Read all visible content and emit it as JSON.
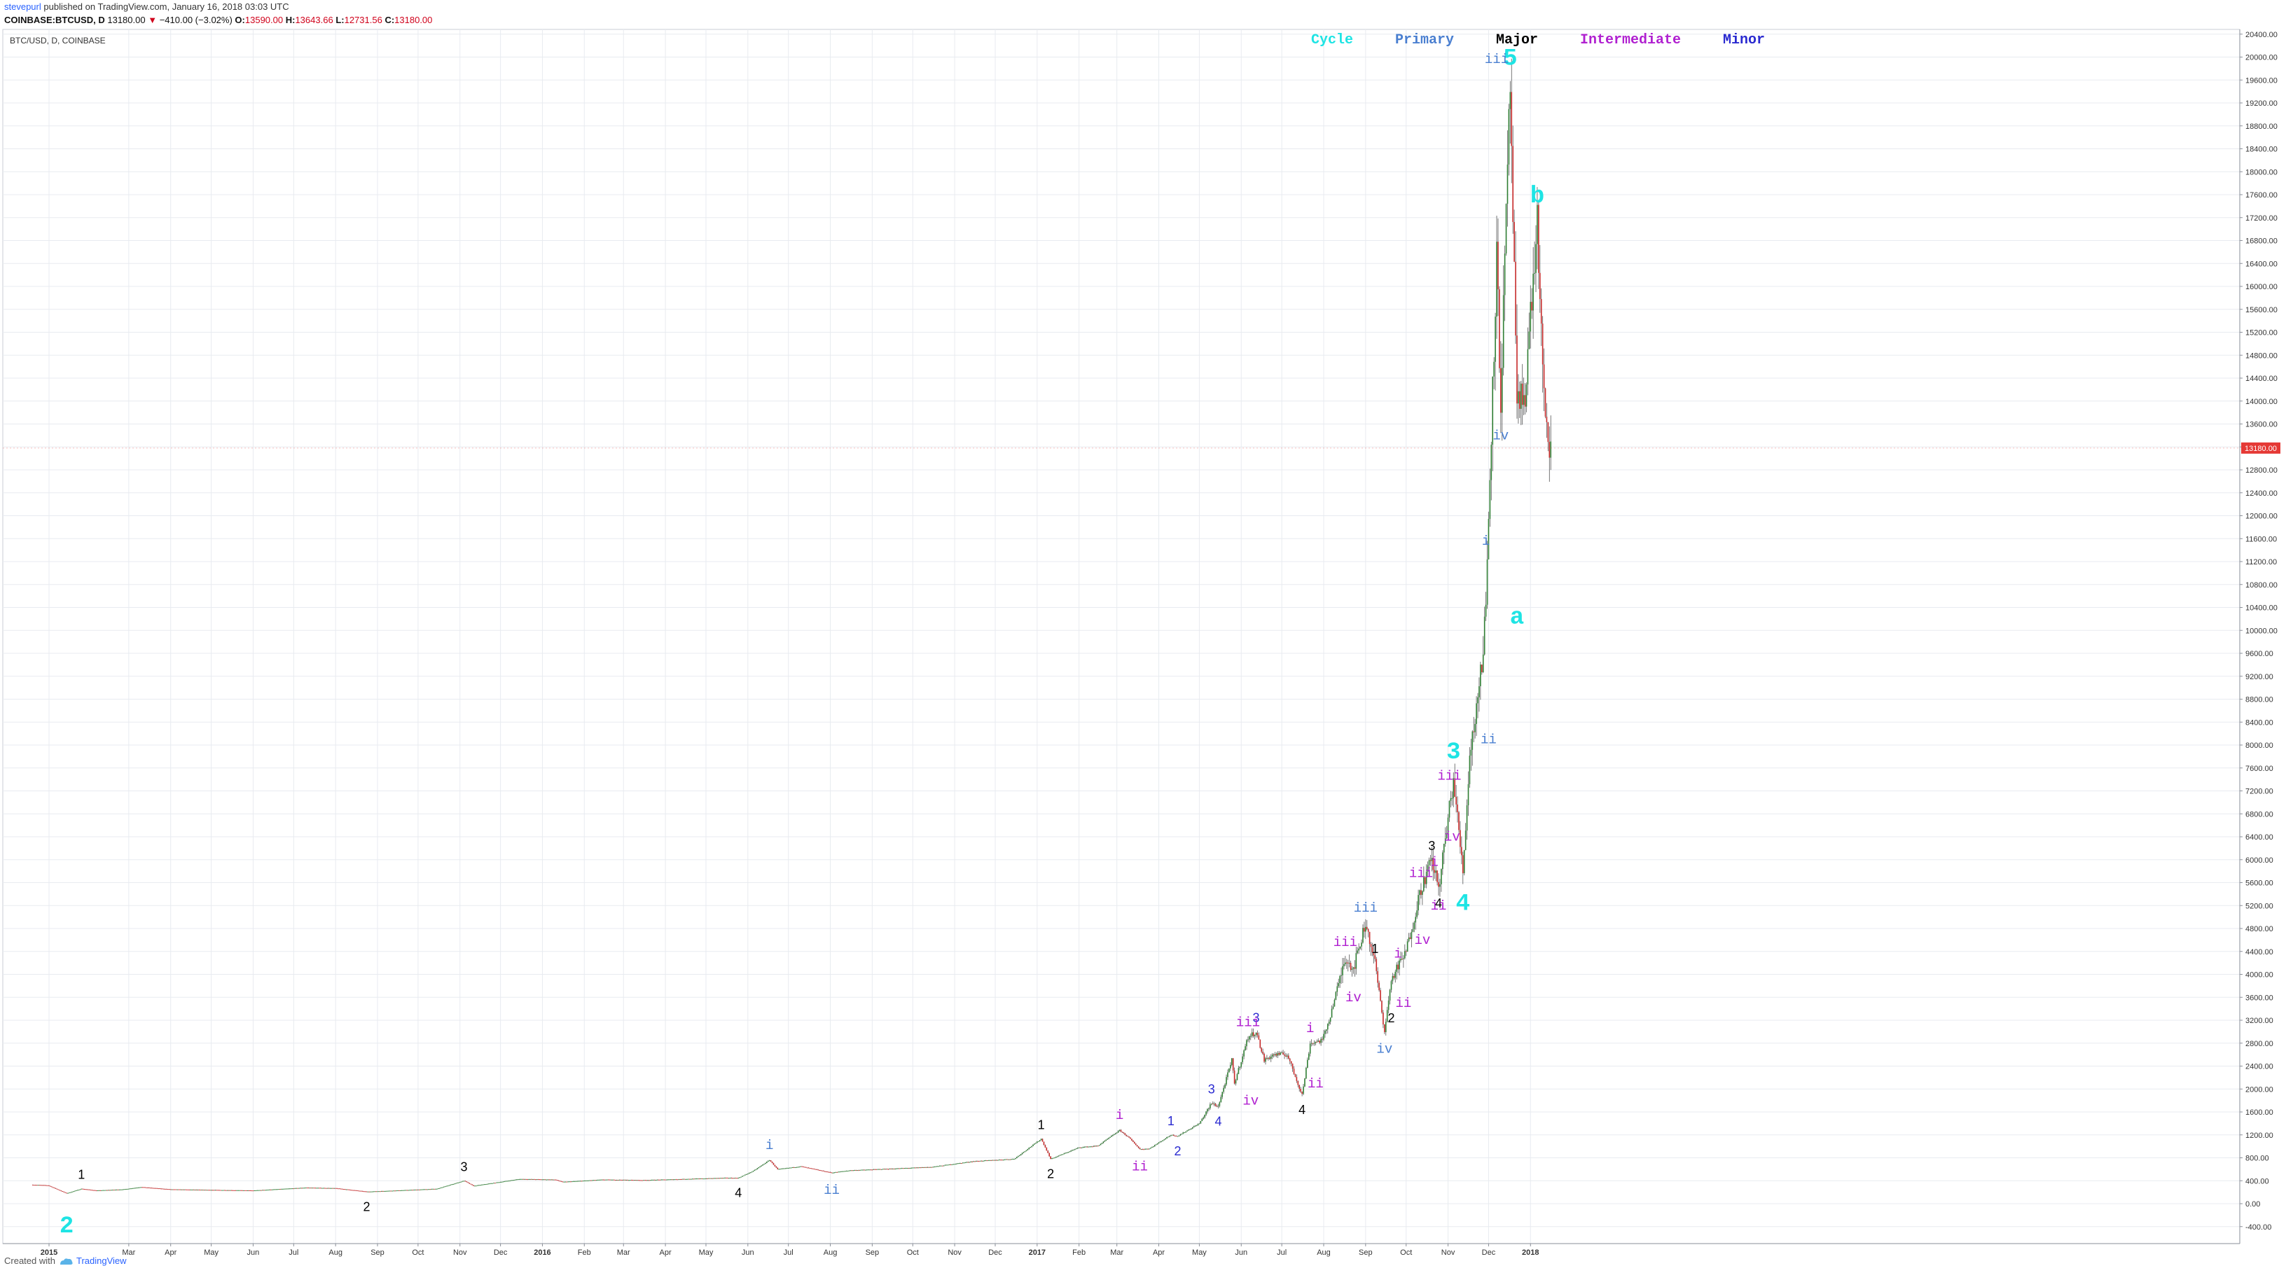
{
  "header": {
    "author": "stevepurl",
    "published": "published on TradingView.com, January 16, 2018 03:03 UTC",
    "symbol": "COINBASE:BTCUSD, D",
    "last": "13180.00",
    "last_arrow": "▼",
    "change": "−410.00 (−3.02%)",
    "o_label": "O:",
    "o_value": "13590.00",
    "h_label": "H:",
    "h_value": "13643.66",
    "l_label": "L:",
    "l_value": "12731.56",
    "c_label": "C:",
    "c_value": "13180.00"
  },
  "footer": {
    "created_with": "Created with",
    "brand": "TradingView"
  },
  "colors": {
    "cycle": "#1ee4e4",
    "primary": "#4a7fd0",
    "major": "#000000",
    "intermediate": "#b020d0",
    "minor": "#2a2ad0",
    "up": "#2e7d32",
    "down": "#c62828",
    "wick": "#555555",
    "price_tag": "#e53935",
    "grid": "#e8ebf0"
  },
  "chart_data": {
    "type": "candlestick",
    "title": "BTC/USD, D, COINBASE",
    "price_label": "13180.00",
    "ylim": [
      -400,
      20400
    ],
    "yticks": [
      -400,
      0,
      400,
      800,
      1200,
      1600,
      2000,
      2400,
      2800,
      3200,
      3600,
      4000,
      4400,
      4800,
      5200,
      5600,
      6000,
      6400,
      6800,
      7200,
      7600,
      8000,
      8400,
      8800,
      9200,
      9600,
      10000,
      10400,
      10800,
      11200,
      11600,
      12000,
      12400,
      12800,
      13200,
      13600,
      14000,
      14400,
      14800,
      15200,
      15600,
      16000,
      16400,
      16800,
      17200,
      17600,
      18000,
      18400,
      18800,
      19200,
      19600,
      20000,
      20400
    ],
    "xticks": [
      {
        "label": "2015",
        "date": "2015-01-01"
      },
      {
        "label": "Mar",
        "date": "2015-03-01"
      },
      {
        "label": "Apr",
        "date": "2015-04-01"
      },
      {
        "label": "May",
        "date": "2015-05-01"
      },
      {
        "label": "Jun",
        "date": "2015-06-01"
      },
      {
        "label": "Jul",
        "date": "2015-07-01"
      },
      {
        "label": "Aug",
        "date": "2015-08-01"
      },
      {
        "label": "Sep",
        "date": "2015-09-01"
      },
      {
        "label": "Oct",
        "date": "2015-10-01"
      },
      {
        "label": "Nov",
        "date": "2015-11-01"
      },
      {
        "label": "Dec",
        "date": "2015-12-01"
      },
      {
        "label": "2016",
        "date": "2016-01-01"
      },
      {
        "label": "Feb",
        "date": "2016-02-01"
      },
      {
        "label": "Mar",
        "date": "2016-03-01"
      },
      {
        "label": "Apr",
        "date": "2016-04-01"
      },
      {
        "label": "May",
        "date": "2016-05-01"
      },
      {
        "label": "Jun",
        "date": "2016-06-01"
      },
      {
        "label": "Jul",
        "date": "2016-07-01"
      },
      {
        "label": "Aug",
        "date": "2016-08-01"
      },
      {
        "label": "Sep",
        "date": "2016-09-01"
      },
      {
        "label": "Oct",
        "date": "2016-10-01"
      },
      {
        "label": "Nov",
        "date": "2016-11-01"
      },
      {
        "label": "Dec",
        "date": "2016-12-01"
      },
      {
        "label": "2017",
        "date": "2017-01-01"
      },
      {
        "label": "Feb",
        "date": "2017-02-01"
      },
      {
        "label": "Mar",
        "date": "2017-03-01"
      },
      {
        "label": "Apr",
        "date": "2017-04-01"
      },
      {
        "label": "May",
        "date": "2017-05-01"
      },
      {
        "label": "Jun",
        "date": "2017-06-01"
      },
      {
        "label": "Jul",
        "date": "2017-07-01"
      },
      {
        "label": "Aug",
        "date": "2017-08-01"
      },
      {
        "label": "Sep",
        "date": "2017-09-01"
      },
      {
        "label": "Oct",
        "date": "2017-10-01"
      },
      {
        "label": "Nov",
        "date": "2017-11-01"
      },
      {
        "label": "Dec",
        "date": "2017-12-01"
      },
      {
        "label": "2018",
        "date": "2018-01-01"
      }
    ],
    "legend": [
      {
        "name": "Cycle",
        "color": "#1ee4e4"
      },
      {
        "name": "Primary",
        "color": "#4a7fd0"
      },
      {
        "name": "Major",
        "color": "#000000"
      },
      {
        "name": "Intermediate",
        "color": "#b020d0"
      },
      {
        "name": "Minor",
        "color": "#2a2ad0"
      }
    ],
    "price_path": [
      [
        "2014-12-20",
        330
      ],
      [
        "2014-12-31",
        320
      ],
      [
        "2015-01-05",
        270
      ],
      [
        "2015-01-14",
        180
      ],
      [
        "2015-01-25",
        260
      ],
      [
        "2015-02-05",
        230
      ],
      [
        "2015-02-25",
        250
      ],
      [
        "2015-03-10",
        290
      ],
      [
        "2015-04-01",
        250
      ],
      [
        "2015-05-01",
        240
      ],
      [
        "2015-06-01",
        230
      ],
      [
        "2015-07-10",
        280
      ],
      [
        "2015-08-01",
        270
      ],
      [
        "2015-08-24",
        210
      ],
      [
        "2015-09-15",
        230
      ],
      [
        "2015-10-15",
        260
      ],
      [
        "2015-11-04",
        400
      ],
      [
        "2015-11-11",
        310
      ],
      [
        "2015-12-01",
        380
      ],
      [
        "2015-12-15",
        430
      ],
      [
        "2016-01-10",
        420
      ],
      [
        "2016-01-16",
        380
      ],
      [
        "2016-02-15",
        420
      ],
      [
        "2016-03-15",
        410
      ],
      [
        "2016-04-15",
        430
      ],
      [
        "2016-05-15",
        450
      ],
      [
        "2016-05-25",
        450
      ],
      [
        "2016-06-05",
        570
      ],
      [
        "2016-06-17",
        760
      ],
      [
        "2016-06-23",
        600
      ],
      [
        "2016-07-10",
        650
      ],
      [
        "2016-08-02",
        540
      ],
      [
        "2016-08-15",
        580
      ],
      [
        "2016-09-15",
        610
      ],
      [
        "2016-10-15",
        640
      ],
      [
        "2016-11-15",
        740
      ],
      [
        "2016-12-15",
        780
      ],
      [
        "2017-01-04",
        1130
      ],
      [
        "2017-01-11",
        780
      ],
      [
        "2017-02-01",
        980
      ],
      [
        "2017-02-15",
        1010
      ],
      [
        "2017-03-03",
        1280
      ],
      [
        "2017-03-10",
        1150
      ],
      [
        "2017-03-18",
        950
      ],
      [
        "2017-03-25",
        960
      ],
      [
        "2017-04-10",
        1200
      ],
      [
        "2017-04-15",
        1180
      ],
      [
        "2017-05-01",
        1400
      ],
      [
        "2017-05-10",
        1750
      ],
      [
        "2017-05-15",
        1700
      ],
      [
        "2017-05-25",
        2500
      ],
      [
        "2017-05-27",
        2100
      ],
      [
        "2017-06-06",
        2900
      ],
      [
        "2017-06-12",
        3000
      ],
      [
        "2017-06-18",
        2500
      ],
      [
        "2017-06-25",
        2600
      ],
      [
        "2017-07-05",
        2600
      ],
      [
        "2017-07-16",
        1900
      ],
      [
        "2017-07-22",
        2800
      ],
      [
        "2017-07-31",
        2850
      ],
      [
        "2017-08-05",
        3200
      ],
      [
        "2017-08-17",
        4300
      ],
      [
        "2017-08-23",
        4100
      ],
      [
        "2017-09-01",
        4900
      ],
      [
        "2017-09-08",
        4200
      ],
      [
        "2017-09-15",
        3000
      ],
      [
        "2017-09-20",
        3900
      ],
      [
        "2017-10-01",
        4400
      ],
      [
        "2017-10-12",
        5500
      ],
      [
        "2017-10-20",
        6000
      ],
      [
        "2017-10-25",
        5500
      ],
      [
        "2017-11-05",
        7400
      ],
      [
        "2017-11-12",
        5800
      ],
      [
        "2017-11-17",
        7800
      ],
      [
        "2017-11-26",
        9400
      ],
      [
        "2017-11-29",
        10500
      ],
      [
        "2017-12-07",
        16500
      ],
      [
        "2017-12-10",
        14000
      ],
      [
        "2017-12-17",
        19500
      ],
      [
        "2017-12-22",
        13800
      ],
      [
        "2017-12-28",
        14200
      ],
      [
        "2018-01-06",
        17100
      ],
      [
        "2018-01-10",
        14500
      ],
      [
        "2018-01-12",
        13500
      ],
      [
        "2018-01-16",
        13180
      ]
    ],
    "wave_labels": [
      {
        "text": "2",
        "date": "2015-01-14",
        "price": 180,
        "pos": "below",
        "degree": "cycle"
      },
      {
        "text": "3",
        "date": "2017-11-05",
        "price": 7400,
        "pos": "above",
        "degree": "cycle"
      },
      {
        "text": "4",
        "date": "2017-11-12",
        "price": 5800,
        "pos": "below",
        "degree": "cycle"
      },
      {
        "text": "5",
        "date": "2017-12-17",
        "price": 19500,
        "pos": "above",
        "degree": "cycle"
      },
      {
        "text": "a",
        "date": "2017-12-22",
        "price": 10800,
        "pos": "below",
        "degree": "cycle"
      },
      {
        "text": "b",
        "date": "2018-01-06",
        "price": 17100,
        "pos": "above",
        "degree": "cycle"
      },
      {
        "text": "i",
        "date": "2016-06-17",
        "price": 760,
        "pos": "above",
        "degree": "primary"
      },
      {
        "text": "ii",
        "date": "2016-08-02",
        "price": 540,
        "pos": "below",
        "degree": "primary"
      },
      {
        "text": "iii",
        "date": "2017-09-01",
        "price": 4900,
        "pos": "above",
        "degree": "primary"
      },
      {
        "text": "iv",
        "date": "2017-09-15",
        "price": 3000,
        "pos": "below",
        "degree": "primary"
      },
      {
        "text": "i",
        "date": "2017-11-29",
        "price": 11300,
        "pos": "above",
        "degree": "primary"
      },
      {
        "text": "ii",
        "date": "2017-12-01",
        "price": 8400,
        "pos": "below",
        "degree": "primary"
      },
      {
        "text": "iii",
        "date": "2017-12-07",
        "price": 19700,
        "pos": "above",
        "degree": "primary"
      },
      {
        "text": "iv",
        "date": "2017-12-10",
        "price": 13700,
        "pos": "below",
        "degree": "primary"
      },
      {
        "text": "1",
        "date": "2015-01-25",
        "price": 260,
        "pos": "above",
        "degree": "major"
      },
      {
        "text": "2",
        "date": "2015-08-24",
        "price": 210,
        "pos": "below",
        "degree": "major"
      },
      {
        "text": "3",
        "date": "2015-11-04",
        "price": 400,
        "pos": "above",
        "degree": "major"
      },
      {
        "text": "4",
        "date": "2016-05-25",
        "price": 450,
        "pos": "below",
        "degree": "major"
      },
      {
        "text": "1",
        "date": "2017-01-04",
        "price": 1130,
        "pos": "above",
        "degree": "major"
      },
      {
        "text": "2",
        "date": "2017-01-11",
        "price": 780,
        "pos": "below",
        "degree": "major"
      },
      {
        "text": "3",
        "date": "2017-06-12",
        "price": 3000,
        "pos": "above",
        "degree": "minor"
      },
      {
        "text": "4",
        "date": "2017-07-16",
        "price": 1900,
        "pos": "below",
        "degree": "major"
      },
      {
        "text": "1",
        "date": "2017-09-08",
        "price": 4200,
        "pos": "above",
        "degree": "major"
      },
      {
        "text": "2",
        "date": "2017-09-20",
        "price": 3500,
        "pos": "below",
        "degree": "major"
      },
      {
        "text": "3",
        "date": "2017-10-20",
        "price": 6000,
        "pos": "above",
        "degree": "major"
      },
      {
        "text": "4",
        "date": "2017-10-25",
        "price": 5500,
        "pos": "below",
        "degree": "major"
      },
      {
        "text": "i",
        "date": "2017-03-03",
        "price": 1280,
        "pos": "above",
        "degree": "intermediate"
      },
      {
        "text": "ii",
        "date": "2017-03-18",
        "price": 950,
        "pos": "below",
        "degree": "intermediate"
      },
      {
        "text": "iii",
        "date": "2017-06-06",
        "price": 2900,
        "pos": "above",
        "degree": "intermediate"
      },
      {
        "text": "iv",
        "date": "2017-06-08",
        "price": 2100,
        "pos": "below",
        "degree": "intermediate"
      },
      {
        "text": "i",
        "date": "2017-07-22",
        "price": 2800,
        "pos": "above",
        "degree": "intermediate"
      },
      {
        "text": "ii",
        "date": "2017-07-26",
        "price": 2400,
        "pos": "below",
        "degree": "intermediate"
      },
      {
        "text": "iii",
        "date": "2017-08-17",
        "price": 4300,
        "pos": "above",
        "degree": "intermediate"
      },
      {
        "text": "iv",
        "date": "2017-08-23",
        "price": 3900,
        "pos": "below",
        "degree": "intermediate"
      },
      {
        "text": "i",
        "date": "2017-09-25",
        "price": 4100,
        "pos": "above",
        "degree": "intermediate"
      },
      {
        "text": "ii",
        "date": "2017-09-29",
        "price": 3800,
        "pos": "below",
        "degree": "intermediate"
      },
      {
        "text": "iii",
        "date": "2017-10-12",
        "price": 5500,
        "pos": "above",
        "degree": "intermediate"
      },
      {
        "text": "iv",
        "date": "2017-10-13",
        "price": 4900,
        "pos": "below",
        "degree": "intermediate"
      },
      {
        "text": "i",
        "date": "2017-10-22",
        "price": 5700,
        "pos": "above",
        "degree": "intermediate"
      },
      {
        "text": "ii",
        "date": "2017-10-25",
        "price": 5500,
        "pos": "below",
        "degree": "intermediate"
      },
      {
        "text": "iii",
        "date": "2017-11-02",
        "price": 7200,
        "pos": "above",
        "degree": "intermediate"
      },
      {
        "text": "iv",
        "date": "2017-11-04",
        "price": 6700,
        "pos": "below",
        "degree": "intermediate"
      },
      {
        "text": "1",
        "date": "2017-04-10",
        "price": 1200,
        "pos": "above",
        "degree": "minor"
      },
      {
        "text": "2",
        "date": "2017-04-15",
        "price": 1180,
        "pos": "below",
        "degree": "minor"
      },
      {
        "text": "3",
        "date": "2017-05-10",
        "price": 1750,
        "pos": "above",
        "degree": "minor"
      },
      {
        "text": "4",
        "date": "2017-05-15",
        "price": 1700,
        "pos": "below",
        "degree": "minor"
      }
    ]
  }
}
